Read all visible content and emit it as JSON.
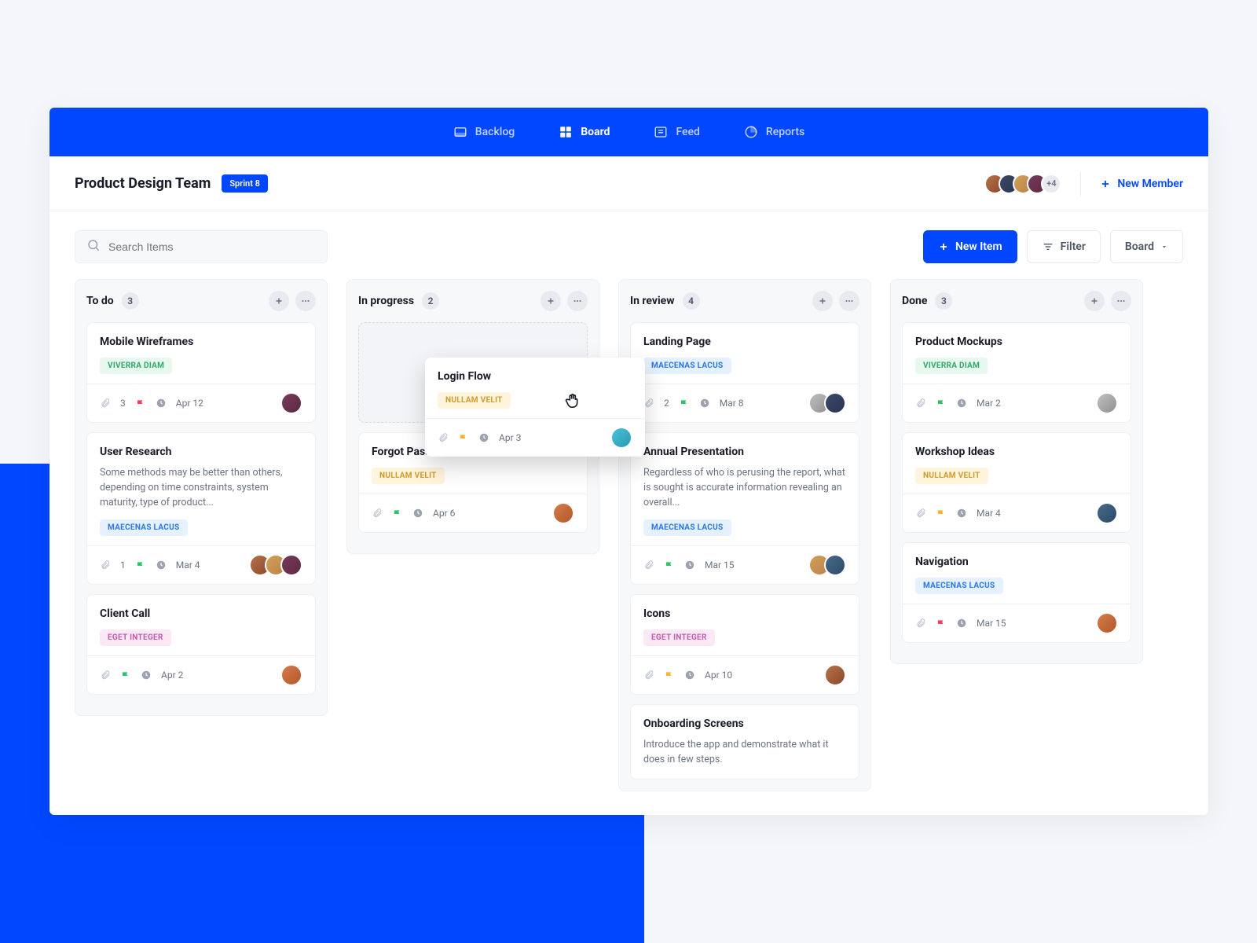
{
  "nav": {
    "backlog": "Backlog",
    "board": "Board",
    "feed": "Feed",
    "reports": "Reports"
  },
  "header": {
    "team": "Product Design Team",
    "sprint": "Sprint 8",
    "more_avatars": "+4",
    "new_member": "New Member"
  },
  "toolbar": {
    "search_placeholder": "Search Items",
    "new_item": "New Item",
    "filter": "Filter",
    "view": "Board"
  },
  "columns": {
    "todo": {
      "title": "To do",
      "count": "3"
    },
    "progress": {
      "title": "In progress",
      "count": "2"
    },
    "review": {
      "title": "In review",
      "count": "4"
    },
    "done": {
      "title": "Done",
      "count": "3"
    }
  },
  "cards": {
    "wireframes": {
      "title": "Mobile Wireframes",
      "tag": "VIVERRA DIAM",
      "attach": "3",
      "date": "Apr 12"
    },
    "research": {
      "title": "User Research",
      "desc": "Some methods may be better than others, depending on time constraints, system maturity, type of product...",
      "tag": "MAECENAS LACUS",
      "attach": "1",
      "date": "Mar 4"
    },
    "client": {
      "title": "Client Call",
      "tag": "EGET INTEGER",
      "date": "Apr 2"
    },
    "login": {
      "title": "Login Flow",
      "tag": "NULLAM VELIT",
      "date": "Apr 3"
    },
    "forgot": {
      "title": "Forgot Password Screen",
      "tag": "NULLAM VELIT",
      "date": "Apr 6"
    },
    "landing": {
      "title": "Landing Page",
      "tag": "MAECENAS LACUS",
      "attach": "2",
      "date": "Mar 8"
    },
    "annual": {
      "title": "Annual Presentation",
      "desc": "Regardless of who is perusing the report, what is sought is accurate information revealing an overall...",
      "tag": "MAECENAS LACUS",
      "date": "Mar 15"
    },
    "icons": {
      "title": "Icons",
      "tag": "EGET INTEGER",
      "date": "Apr 10"
    },
    "onboarding": {
      "title": "Onboarding Screens",
      "desc": "Introduce the app and demonstrate what it does in few steps."
    },
    "mockups": {
      "title": "Product Mockups",
      "tag": "VIVERRA DIAM",
      "date": "Mar 2"
    },
    "workshop": {
      "title": "Workshop Ideas",
      "tag": "NULLAM VELIT",
      "date": "Mar 4"
    },
    "navigation": {
      "title": "Navigation",
      "tag": "MAECENAS LACUS",
      "date": "Mar 15"
    }
  }
}
